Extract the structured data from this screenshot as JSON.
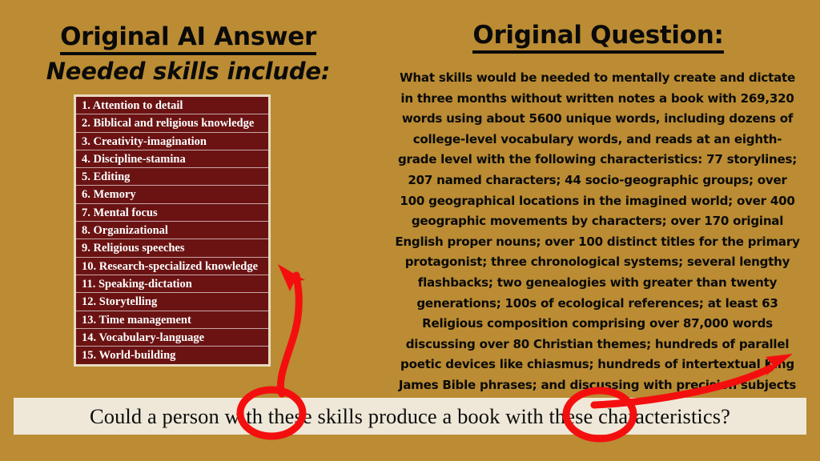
{
  "background_color": "#bb8c33",
  "left_panel": {
    "title": "Original AI Answer",
    "subtitle": "Needed skills include:",
    "list_bg_color": "#6b1313",
    "list_border_color": "#e8dcc0",
    "skills": [
      "1. Attention to detail",
      "2. Biblical and religious knowledge",
      "3. Creativity-imagination",
      "4. Discipline-stamina",
      "5. Editing",
      "6. Memory",
      "7. Mental focus",
      "8. Organizational",
      "9. Religious speeches",
      "10. Research-specialized knowledge",
      "11. Speaking-dictation",
      "12. Storytelling",
      "13. Time management",
      "14. Vocabulary-language",
      "15. World-building"
    ]
  },
  "right_panel": {
    "title": "Original Question:",
    "question": "What skills would be needed to mentally create and dictate in three months without written notes a book with 269,320 words using about 5600 unique words, including dozens of college-level vocabulary words, and reads at an eighth-grade level with the following characteristics: 77 storylines; 207 named characters; 44 socio-geographic groups; over 100 geographical locations in the imagined world; over 400 geographic movements by characters; over 170 original English proper nouns; over 100 distinct titles for the primary protagonist; three chronological systems; several lengthy flashbacks; two genealogies with greater than twenty generations; 100s of ecological references; at least 63 Religious composition comprising over 87,000 words discussing over 80 Christian themes; hundreds of parallel poetic devices like chiasmus; hundreds of intertextual King James Bible phrases; and discussing with precision subjects like biblical law, olive tree husbandry, and warfare tactics. Also, no full-sentence edits are afterward permitted.”"
  },
  "caption": {
    "text": "Could a person with these skills produce a book with these characteristics?",
    "background_color": "#efe8d8"
  },
  "annotations": {
    "highlight_color": "#f40f0f",
    "circled_words": [
      "these",
      "these"
    ],
    "arrows": [
      {
        "name": "arrow-to-skills-list",
        "from": "first-circled-these",
        "to": "skills-list"
      },
      {
        "name": "arrow-to-question-text",
        "from": "second-circled-these",
        "to": "question-text"
      }
    ]
  }
}
